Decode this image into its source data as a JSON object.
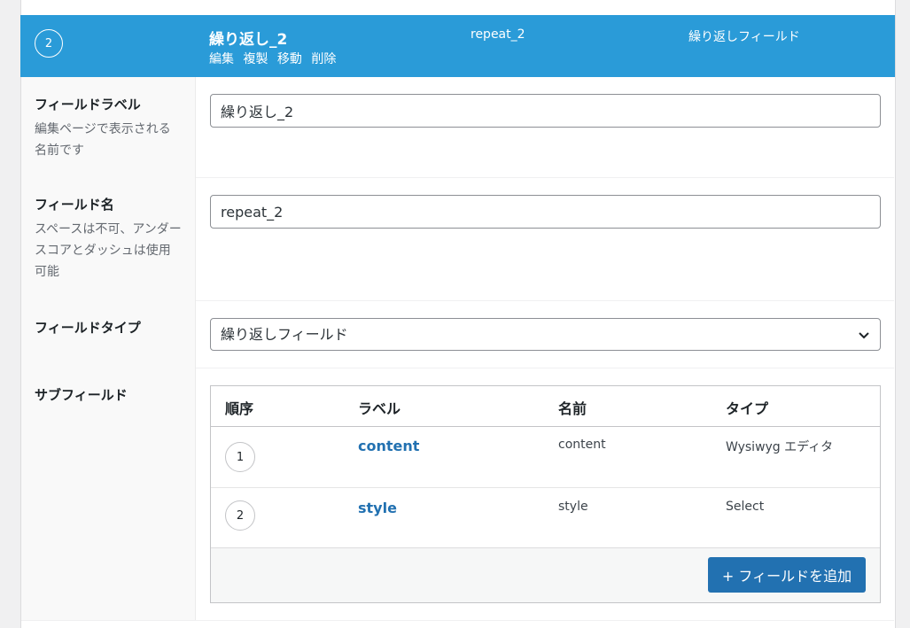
{
  "header": {
    "order": "2",
    "title": "繰り返し_2",
    "actions": [
      "編集",
      "複製",
      "移動",
      "削除"
    ],
    "name": "repeat_2",
    "type": "繰り返しフィールド"
  },
  "fields": {
    "label": {
      "title": "フィールドラベル",
      "desc": "編集ページで表示される名前です",
      "value": "繰り返し_2"
    },
    "name": {
      "title": "フィールド名",
      "desc": "スペースは不可、アンダースコアとダッシュは使用可能",
      "value": "repeat_2"
    },
    "type": {
      "title": "フィールドタイプ",
      "value": "繰り返しフィールド"
    },
    "subfields": {
      "title": "サブフィールド",
      "columns": [
        "順序",
        "ラベル",
        "名前",
        "タイプ"
      ],
      "rows": [
        {
          "order": "1",
          "label": "content",
          "name": "content",
          "type": "Wysiwyg エディタ"
        },
        {
          "order": "2",
          "label": "style",
          "name": "style",
          "type": "Select"
        }
      ],
      "add_button": "+ フィールドを追加"
    }
  },
  "colors": {
    "header_bg": "#2a9bd8",
    "primary": "#2271b1"
  }
}
